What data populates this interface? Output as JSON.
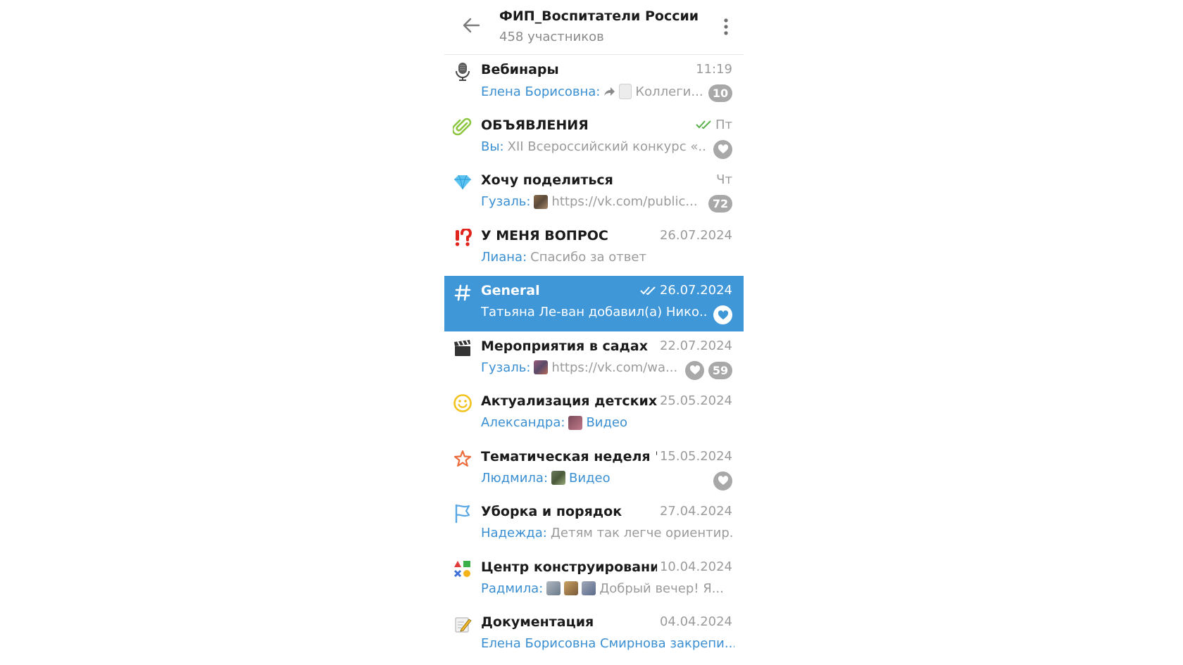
{
  "header": {
    "title": "ФИП_Воспитатели России",
    "subtitle": "458 участников",
    "back_icon": "arrow-left-icon",
    "menu_icon": "more-vertical-icon"
  },
  "colors": {
    "accent": "#3f97d8",
    "sender": "#3a8fd3",
    "badge": "#a8a8a8",
    "read_check": "#5ab04a"
  },
  "topics": [
    {
      "icon": "microphone-icon",
      "title": "Вебинары",
      "date": "11:19",
      "sender": "Елена Борисовна:",
      "preview": "Коллеги...",
      "badge": "10"
    },
    {
      "icon": "paperclip-icon",
      "title": "ОБЪЯВЛЕНИЯ",
      "date": "Пт",
      "sender": "Вы:",
      "preview": "XII Всероссийский конкурс «..."
    },
    {
      "icon": "diamond-icon",
      "title": "Хочу поделиться",
      "date": "Чт",
      "sender": "Гузаль:",
      "preview": "https://vk.com/public...",
      "badge": "72"
    },
    {
      "icon": "exclamation-question-icon",
      "title": "У МЕНЯ ВОПРОС",
      "date": "26.07.2024",
      "sender": "Лиана:",
      "preview": "Спасибо за ответ"
    },
    {
      "icon": "hashtag-icon",
      "title": "General",
      "date": "26.07.2024",
      "preview": "Татьяна Ле-ван добавил(а) Нико..."
    },
    {
      "icon": "clapperboard-icon",
      "title": "Мероприятия в садах",
      "date": "22.07.2024",
      "sender": "Гузаль:",
      "preview": "https://vk.com/wa...",
      "badge": "59"
    },
    {
      "icon": "smiley-icon",
      "title": "Актуализация детских п...",
      "date": "25.05.2024",
      "sender": "Александра:",
      "preview": "Видео"
    },
    {
      "icon": "star-icon",
      "title": "Тематическая неделя \"С...",
      "date": "15.05.2024",
      "sender": "Людмила:",
      "preview": "Видео"
    },
    {
      "icon": "flag-icon",
      "title": "Уборка и порядок",
      "date": "27.04.2024",
      "sender": "Надежда:",
      "preview": "Детям так легче ориентир..."
    },
    {
      "icon": "shapes-icon",
      "title": "Центр конструирования",
      "date": "10.04.2024",
      "sender": "Радмила:",
      "preview": "Добрый вечер! Я..."
    },
    {
      "icon": "memo-icon",
      "title": "Документация",
      "date": "04.04.2024",
      "preview": "Елена Борисовна Смирнова закрепи..."
    }
  ]
}
